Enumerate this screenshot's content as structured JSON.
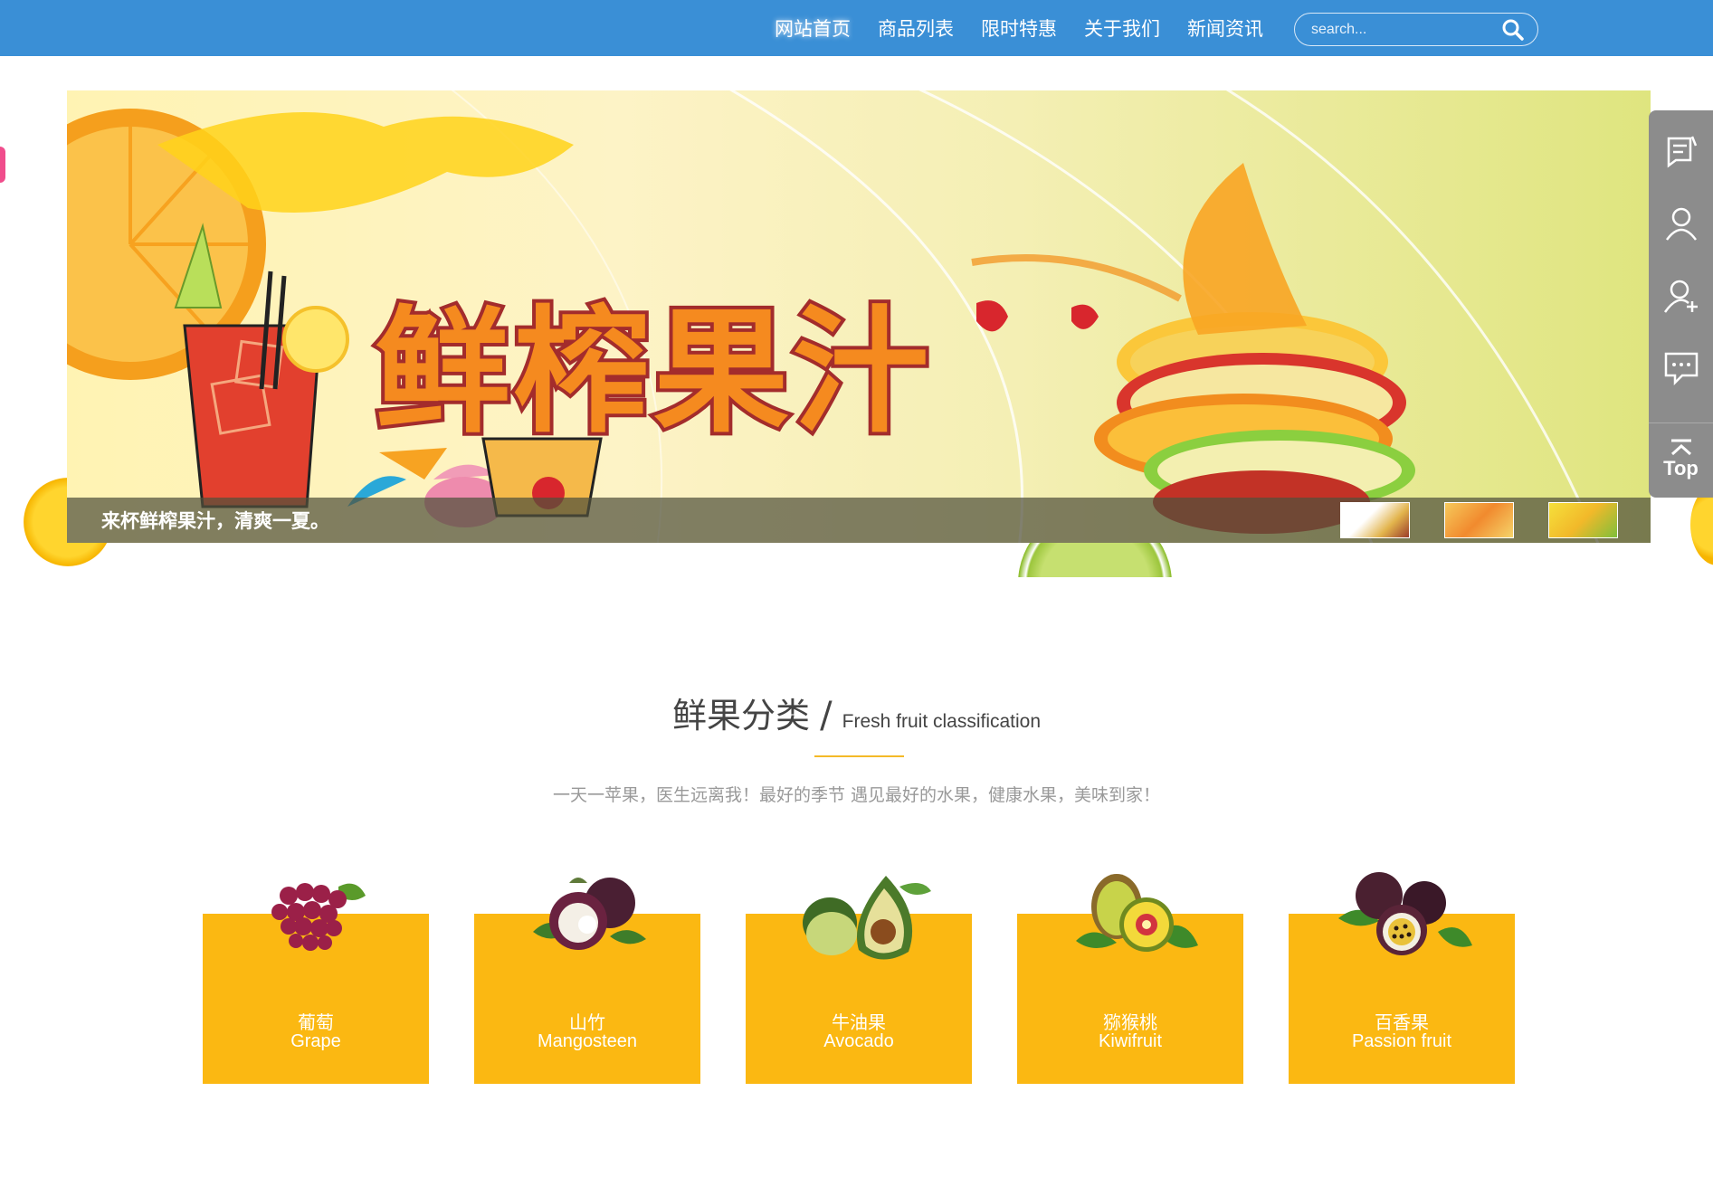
{
  "nav": {
    "items": [
      {
        "label": "网站首页",
        "active": true
      },
      {
        "label": "商品列表",
        "active": false
      },
      {
        "label": "限时特惠",
        "active": false
      },
      {
        "label": "关于我们",
        "active": false
      },
      {
        "label": "新闻资讯",
        "active": false
      }
    ],
    "search_placeholder": "search..."
  },
  "banner": {
    "title": "鲜榨果汁",
    "caption": "来杯鲜榨果汁，清爽一夏。",
    "thumbnails": 3
  },
  "sidebar": {
    "icons": [
      "feedback-icon",
      "user-icon",
      "add-user-icon",
      "chat-icon"
    ],
    "top_label": "Top"
  },
  "section": {
    "title_cn": "鲜果分类",
    "separator": "/",
    "title_en": "Fresh fruit classification",
    "subtitle": "一天一苹果，医生远离我！最好的季节 遇见最好的水果，健康水果，美味到家！"
  },
  "categories": [
    {
      "cn": "葡萄",
      "en": "Grape",
      "icon": "grape-icon"
    },
    {
      "cn": "山竹",
      "en": "Mangosteen",
      "icon": "mangosteen-icon"
    },
    {
      "cn": "牛油果",
      "en": "Avocado",
      "icon": "avocado-icon"
    },
    {
      "cn": "猕猴桃",
      "en": "Kiwifruit",
      "icon": "kiwifruit-icon"
    },
    {
      "cn": "百香果",
      "en": "Passion fruit",
      "icon": "passion-fruit-icon"
    }
  ],
  "colors": {
    "nav_bg": "#3a8fd6",
    "card_bg": "#fbb812",
    "accent_line": "#f4b928",
    "sidebar_bg": "#8c8c8c"
  }
}
